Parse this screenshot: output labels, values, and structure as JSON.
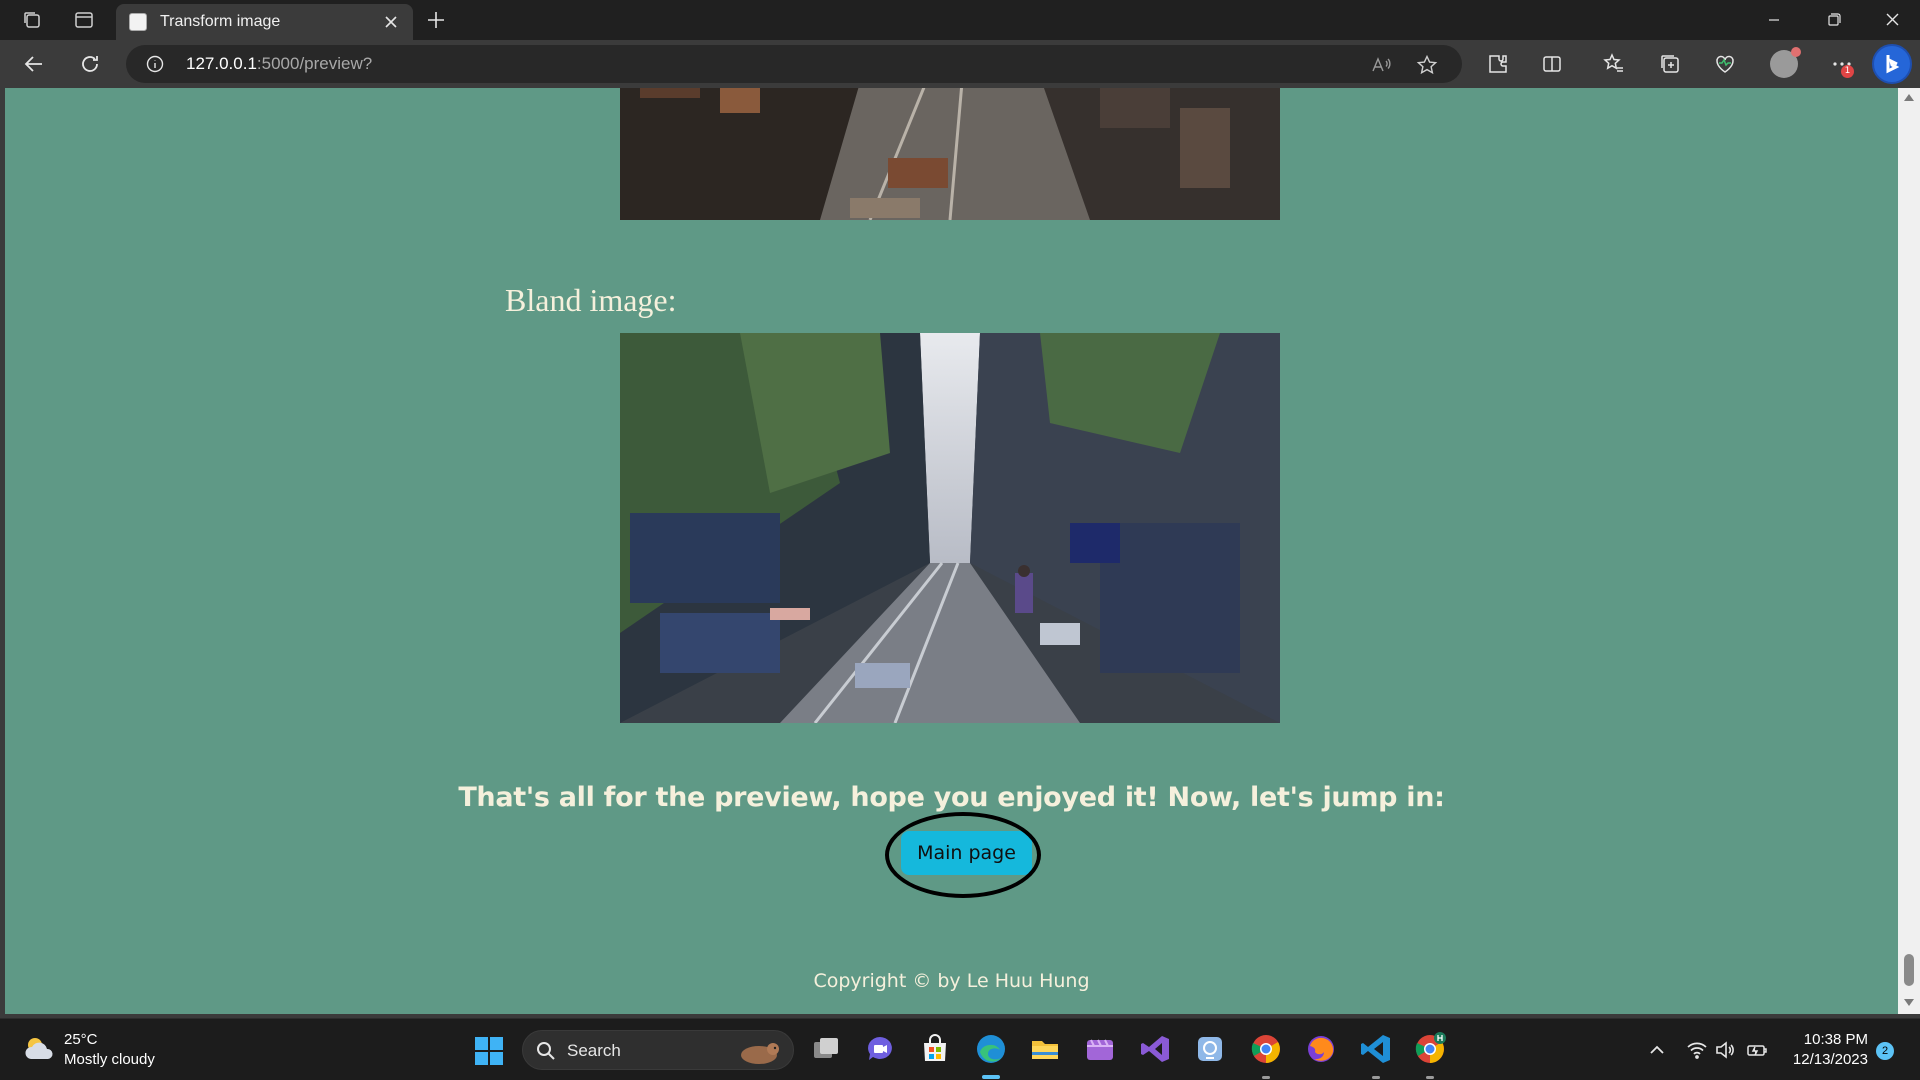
{
  "browser": {
    "tab_title": "Transform image",
    "url_host": "127.0.0.1",
    "url_path": ":5000/preview?",
    "notification_badge": "1"
  },
  "page": {
    "background": "#5f9986",
    "section_title": "Bland image:",
    "closing_text": "That's all for the preview, hope you enjoyed it! Now, let's jump in:",
    "main_button_label": "Main page",
    "button_color": "#15b8dc",
    "copyright": "Copyright © by Le Huu Hung"
  },
  "taskbar": {
    "weather_temp": "25°C",
    "weather_desc": "Mostly cloudy",
    "search_label": "Search",
    "clock_time": "10:38 PM",
    "clock_date": "12/13/2023",
    "notification_count": "2",
    "apps": [
      "task-view",
      "meet",
      "store",
      "edge",
      "file-explorer",
      "media",
      "visual-studio",
      "app-blue",
      "chrome",
      "firefox",
      "vscode",
      "chrome-profile"
    ]
  }
}
